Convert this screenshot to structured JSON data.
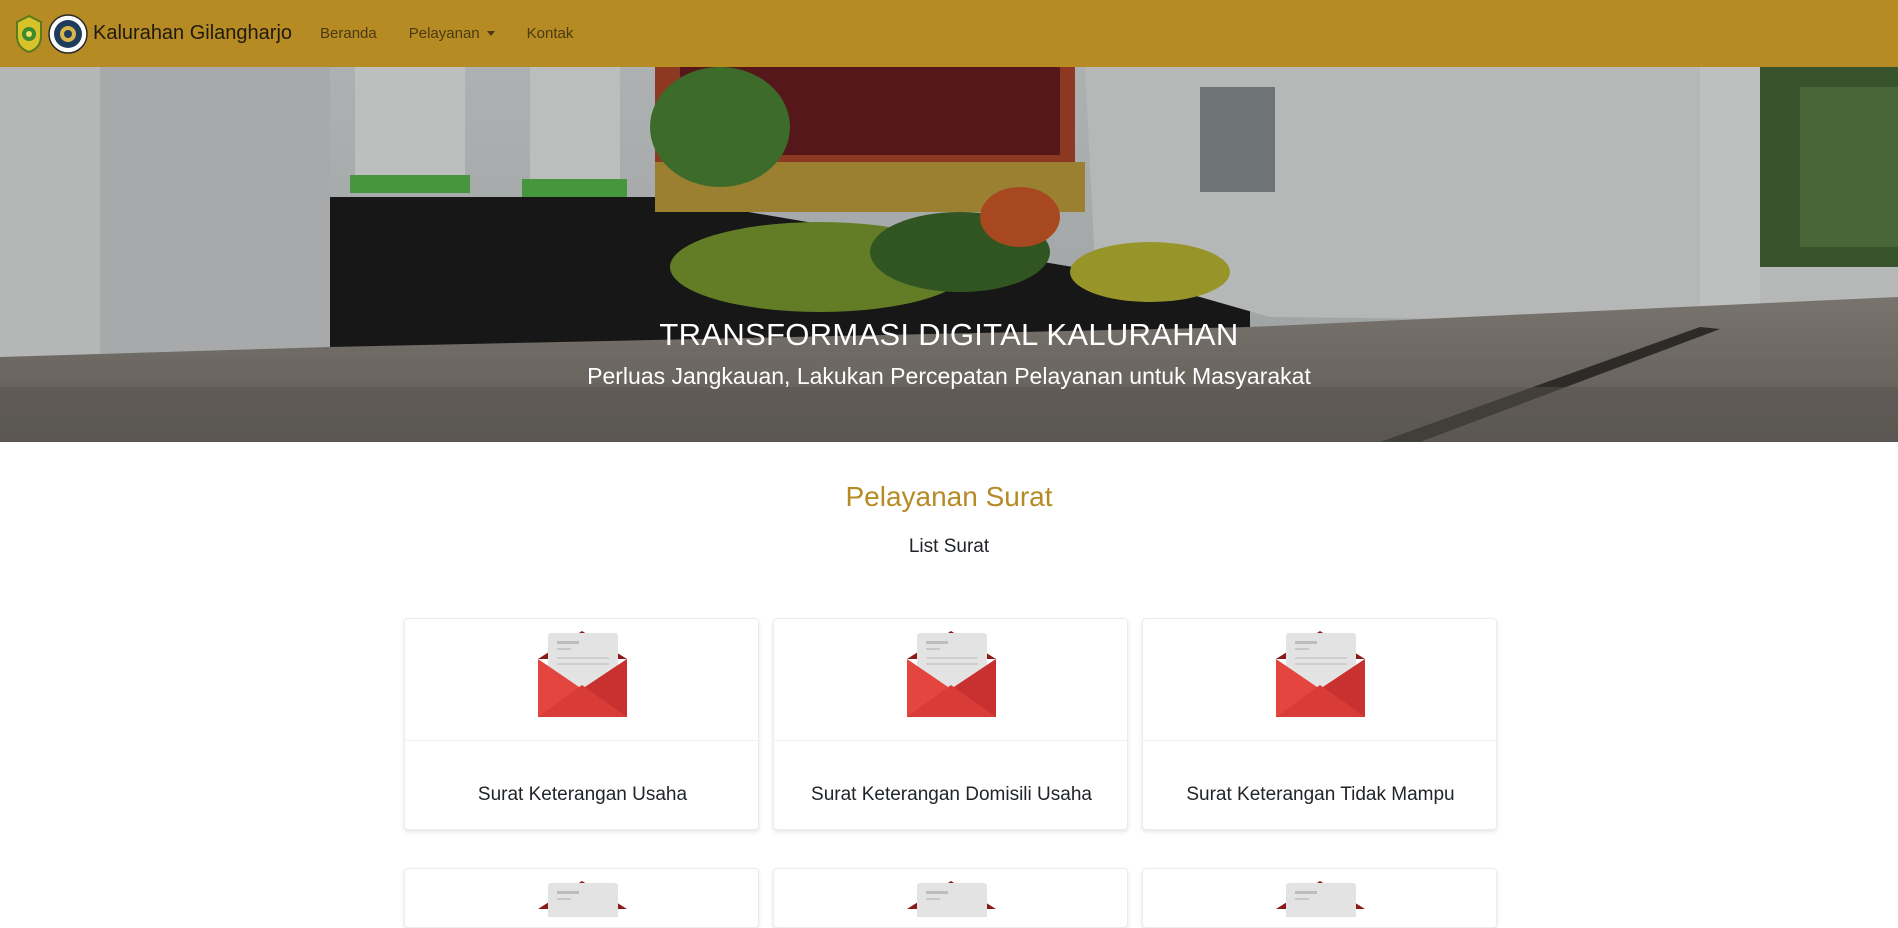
{
  "navbar": {
    "brand": "Kalurahan Gilangharjo",
    "links": [
      {
        "label": "Beranda"
      },
      {
        "label": "Pelayanan",
        "dropdown": true
      },
      {
        "label": "Kontak"
      }
    ],
    "bg_color": "#b68b24"
  },
  "hero": {
    "title": "TRANSFORMASI DIGITAL KALURAHAN",
    "subtitle": "Perluas Jangkauan, Lakukan Percepatan Pelayanan untuk Masyarakat"
  },
  "services": {
    "title": "Pelayanan Surat",
    "subtitle": "List Surat",
    "cards": [
      {
        "label": "Surat Keterangan Usaha",
        "icon": "envelope-letter-icon"
      },
      {
        "label": "Surat Keterangan Domisili Usaha",
        "icon": "envelope-letter-icon"
      },
      {
        "label": "Surat Keterangan Tidak Mampu",
        "icon": "envelope-letter-icon"
      }
    ],
    "accent_color": "#b68b24"
  }
}
